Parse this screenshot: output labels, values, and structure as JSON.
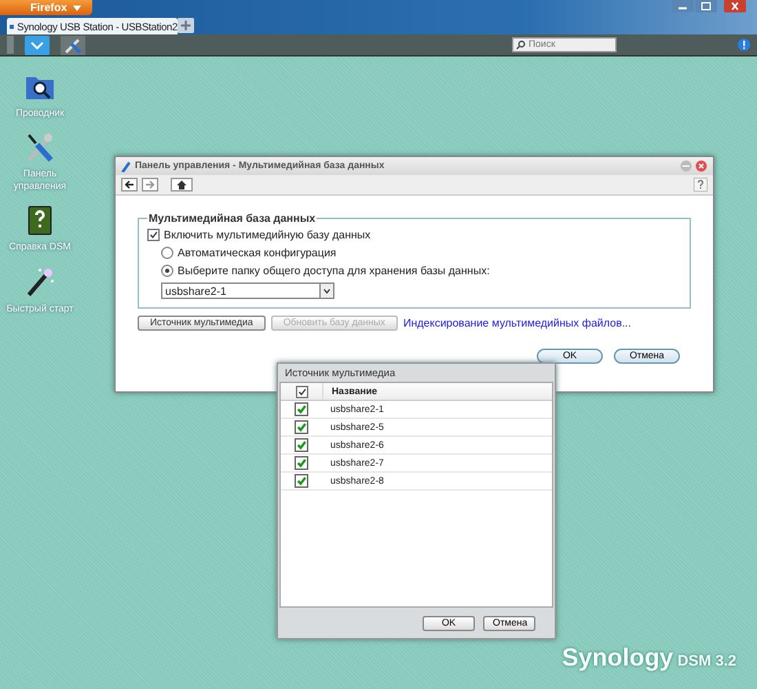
{
  "browser": {
    "menu_button": "Firefox",
    "tab": {
      "title": "Synology USB Station - USBStation2",
      "selected": true
    },
    "search": {
      "placeholder": "Поиск"
    }
  },
  "desktop_icons": [
    {
      "kind": "explorer",
      "label": "Проводник"
    },
    {
      "kind": "tools",
      "label": "Панель управления"
    },
    {
      "kind": "help",
      "label": "Справка DSM"
    },
    {
      "kind": "wand",
      "label": "Быстрый старт"
    }
  ],
  "main_window": {
    "title": "Панель управления - Мультимедийная база данных",
    "group_title": "Мультимедийная база данных",
    "enable": {
      "label": "Включить мультимедийную базу данных",
      "checked": true
    },
    "options": [
      {
        "label": "Автоматическая конфигурация",
        "selected": false
      },
      {
        "label": "Выберите папку общего доступа для хранения базы данных:",
        "selected": true
      }
    ],
    "share_select": {
      "value": "usbshare2-1"
    },
    "buttons": [
      {
        "label": "Источник мультимедиа",
        "disabled": false
      },
      {
        "label": "Обновить базу данных",
        "disabled": true
      }
    ],
    "link": "Индексирование мультимедийных файлов...",
    "footer_buttons": [
      "OK",
      "Отмена"
    ]
  },
  "popup": {
    "title": "Источник мультимедиа",
    "select_all": {
      "checked": true
    },
    "column": "Название",
    "rows": [
      {
        "name": "usbshare2-1",
        "checked": true
      },
      {
        "name": "usbshare2-5",
        "checked": true
      },
      {
        "name": "usbshare2-6",
        "checked": true
      },
      {
        "name": "usbshare2-7",
        "checked": true
      },
      {
        "name": "usbshare2-8",
        "checked": true
      }
    ],
    "buttons": [
      "OK",
      "Отмена"
    ]
  },
  "brand": {
    "name": "Synology",
    "version": "DSM 3.2"
  }
}
